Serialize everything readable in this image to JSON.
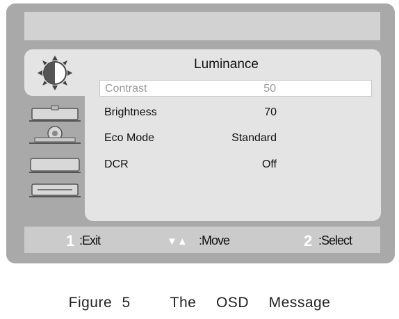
{
  "menu": {
    "title": "Luminance",
    "items": [
      {
        "label": "Contrast",
        "value": "50"
      },
      {
        "label": "Brightness",
        "value": "70"
      },
      {
        "label": "Eco Mode",
        "value": "Standard"
      },
      {
        "label": "DCR",
        "value": "Off"
      }
    ]
  },
  "sidebar": {
    "icons": [
      "luminance-icon",
      "image-setup-icon",
      "color-temp-icon",
      "osd-setup-icon",
      "extra-settings-icon"
    ]
  },
  "footer": {
    "exit_key": "1",
    "exit_label": ":Exit",
    "move_key": "▼▲",
    "move_label": ":Move",
    "select_key": "2",
    "select_label": ":Select"
  },
  "caption": "Figure 5    The  OSD  Message",
  "colors": {
    "frame": "#a9a9a9",
    "panel": "#e4e4e4",
    "title_bar": "#d2d2d2",
    "footer_bar": "#cbcbcb"
  }
}
